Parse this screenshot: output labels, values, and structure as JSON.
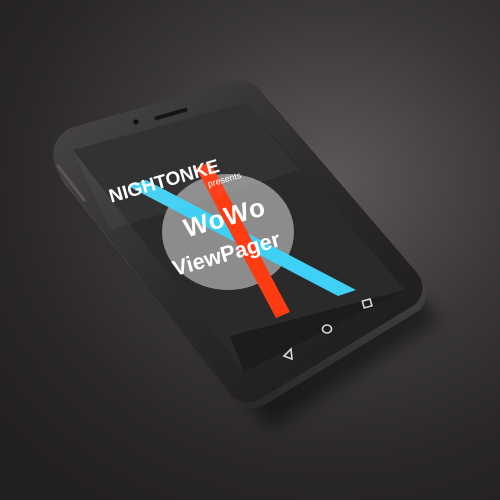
{
  "splash": {
    "brand": "NIGHTONKE",
    "tagline": "presents",
    "title": "WoWo",
    "subtitle": "ViewPager"
  },
  "navbar": {
    "back_icon": "triangle-back-icon",
    "home_icon": "circle-home-icon",
    "recents_icon": "square-recents-icon"
  },
  "colors": {
    "stripe_blue": "#3fd0f5",
    "stripe_red": "#ff3b12",
    "circle": "#8c8c8c",
    "screen": "#2a2a2a",
    "text": "#ffffff"
  }
}
